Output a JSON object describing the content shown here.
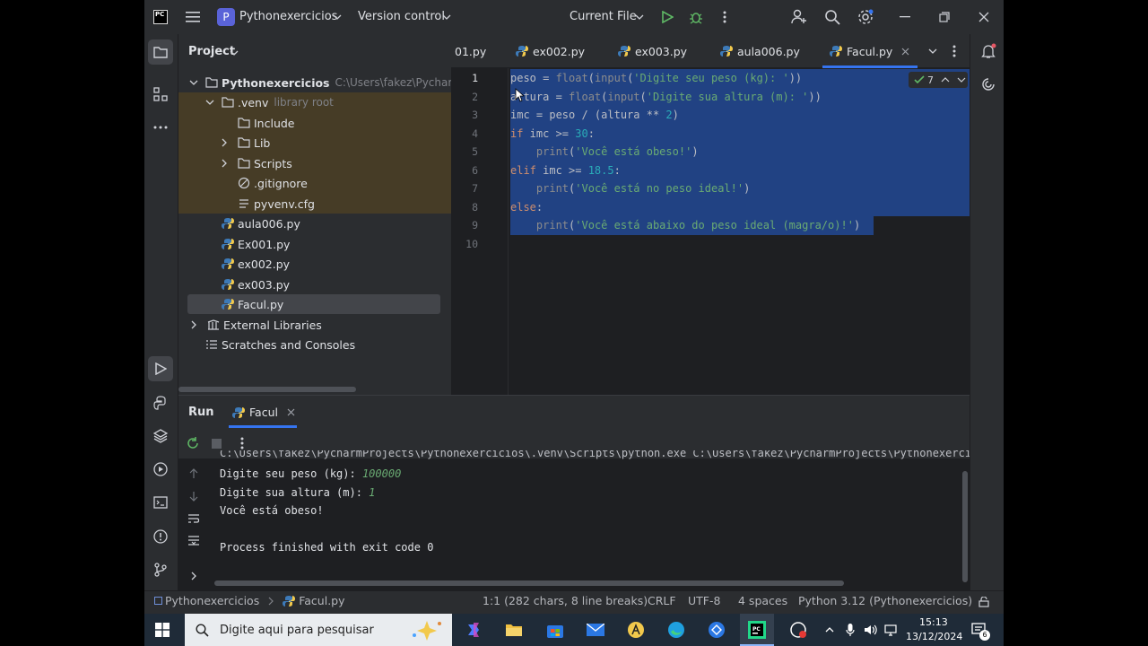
{
  "titlebar": {
    "project_badge": "P",
    "project_name": "Pythonexercicios",
    "vcs": "Version control",
    "run_config": "Current File"
  },
  "project_pane": {
    "title": "Project",
    "root": {
      "name": "Pythonexercicios",
      "path": "C:\\Users\\fakez\\PycharmP"
    },
    "venv": {
      "name": ".venv",
      "hint": "library root"
    },
    "venv_children": [
      "Include",
      "Lib",
      "Scripts",
      ".gitignore",
      "pyvenv.cfg"
    ],
    "files": [
      "aula006.py",
      "Ex001.py",
      "ex002.py",
      "ex003.py",
      "Facul.py"
    ],
    "external": "External Libraries",
    "scratches": "Scratches and Consoles"
  },
  "editor": {
    "tabs": [
      {
        "label": "01.py",
        "active": false
      },
      {
        "label": "ex002.py",
        "active": false
      },
      {
        "label": "ex003.py",
        "active": false
      },
      {
        "label": "aula006.py",
        "active": false
      },
      {
        "label": "Facul.py",
        "active": true
      }
    ],
    "inspection_count": "7",
    "lines": [
      "peso = float(input('Digite seu peso (kg): '))",
      "altura = float(input('Digite sua altura (m): '))",
      "imc = peso / (altura ** 2)",
      "if imc >= 30:",
      "    print('Você está obeso!')",
      "elif imc >= 18.5:",
      "    print('Você está no peso ideal!')",
      "else:",
      "    print('Você está abaixo do peso ideal (magra/o)!')",
      ""
    ],
    "line_numbers": [
      "1",
      "2",
      "3",
      "4",
      "5",
      "6",
      "7",
      "8",
      "9",
      "10"
    ]
  },
  "run": {
    "tab_run": "Run",
    "tab_config": "Facul",
    "cmd_line": "C:\\Users\\fakez\\PycharmProjects\\Pythonexercicios\\.venv\\Scripts\\python.exe C:\\Users\\fakez\\PycharmProjects\\Pythonexercicios\\Facul.py",
    "prompt1": "Digite seu peso (kg): ",
    "input1": "100000",
    "prompt2": "Digite sua altura (m): ",
    "input2": "1",
    "result": "Você está obeso!",
    "exit": "Process finished with exit code 0"
  },
  "statusbar": {
    "crumb_project": "Pythonexercicios",
    "crumb_file": "Facul.py",
    "position": "1:1 (282 chars, 8 line breaks)",
    "line_sep": "CRLF",
    "encoding": "UTF-8",
    "indent": "4 spaces",
    "interpreter": "Python 3.12 (Pythonexercicios)"
  },
  "taskbar": {
    "search_placeholder": "Digite aqui para pesquisar",
    "time": "15:13",
    "date": "13/12/2024",
    "notif_count": "6"
  },
  "colors": {
    "accent": "#3574f0",
    "selection": "#214283",
    "run_green": "#5fb865"
  }
}
